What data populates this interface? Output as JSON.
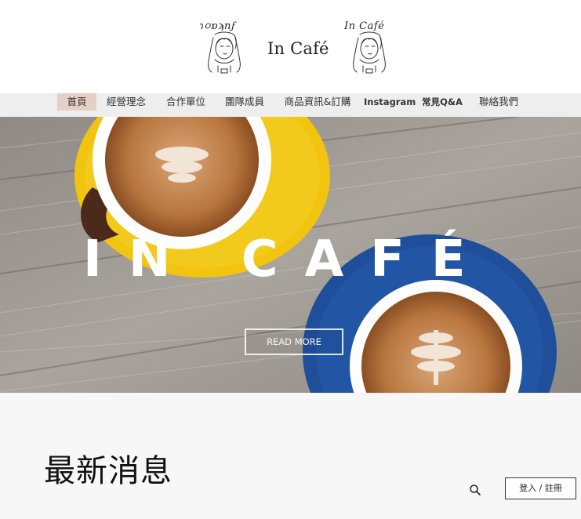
{
  "header": {
    "brand_title": "In Café",
    "logo_left_text": "ɿ૦ɒϡnϝ",
    "logo_right_text": "In Café"
  },
  "nav": {
    "items": [
      {
        "label": "首頁",
        "active": true
      },
      {
        "label": "經營理念",
        "active": false
      },
      {
        "label": "合作單位",
        "active": false
      },
      {
        "label": "團隊成員",
        "active": false
      },
      {
        "label": "商品資訊&訂購",
        "active": false
      },
      {
        "label": "Instagram",
        "active": false
      },
      {
        "label": "常見Q&A",
        "active": false
      },
      {
        "label": "聯絡我們",
        "active": false
      }
    ],
    "active_color": "#e8cfc6",
    "bar_color": "#eeeeee"
  },
  "hero": {
    "title": "IN CAFÉ",
    "button_label": "READ MORE"
  },
  "section": {
    "title": "最新消息",
    "login_label": "登入 / 註冊"
  },
  "icons": {
    "search": "search-icon",
    "logo": "woman-sketch-logo-icon"
  },
  "colors": {
    "cup_yellow": "#f1c40f",
    "cup_blue": "#1f4f9a",
    "wood": "#9a9690"
  }
}
